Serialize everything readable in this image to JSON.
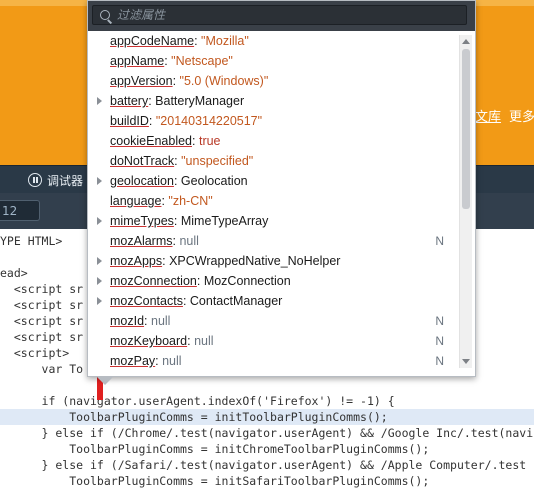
{
  "website": {
    "links": [
      "文库",
      "更多"
    ]
  },
  "devtools": {
    "debugger_tab": "调试器",
    "tab_box": "12"
  },
  "popup": {
    "filter_placeholder": "过滤属性",
    "rows": [
      {
        "key": "appCodeName",
        "value": "\"Mozilla\"",
        "vclass": "s",
        "expandable": false,
        "type": ""
      },
      {
        "key": "appName",
        "value": "\"Netscape\"",
        "vclass": "s",
        "expandable": false,
        "type": ""
      },
      {
        "key": "appVersion",
        "value": "\"5.0 (Windows)\"",
        "vclass": "s",
        "expandable": false,
        "type": ""
      },
      {
        "key": "battery",
        "value": "BatteryManager",
        "vclass": "",
        "expandable": true,
        "type": ""
      },
      {
        "key": "buildID",
        "value": "\"20140314220517\"",
        "vclass": "s",
        "expandable": false,
        "type": ""
      },
      {
        "key": "cookieEnabled",
        "value": "true",
        "vclass": "b",
        "expandable": false,
        "type": ""
      },
      {
        "key": "doNotTrack",
        "value": "\"unspecified\"",
        "vclass": "s",
        "expandable": false,
        "type": ""
      },
      {
        "key": "geolocation",
        "value": "Geolocation",
        "vclass": "",
        "expandable": true,
        "type": ""
      },
      {
        "key": "language",
        "value": "\"zh-CN\"",
        "vclass": "s",
        "expandable": false,
        "type": ""
      },
      {
        "key": "mimeTypes",
        "value": "MimeTypeArray",
        "vclass": "",
        "expandable": true,
        "type": ""
      },
      {
        "key": "mozAlarms",
        "value": "null",
        "vclass": "n",
        "expandable": false,
        "type": "N"
      },
      {
        "key": "mozApps",
        "value": "XPCWrappedNative_NoHelper",
        "vclass": "",
        "expandable": true,
        "type": ""
      },
      {
        "key": "mozConnection",
        "value": "MozConnection",
        "vclass": "",
        "expandable": true,
        "type": ""
      },
      {
        "key": "mozContacts",
        "value": "ContactManager",
        "vclass": "",
        "expandable": true,
        "type": ""
      },
      {
        "key": "mozId",
        "value": "null",
        "vclass": "n",
        "expandable": false,
        "type": "N"
      },
      {
        "key": "mozKeyboard",
        "value": "null",
        "vclass": "n",
        "expandable": false,
        "type": "N"
      },
      {
        "key": "mozPay",
        "value": "null",
        "vclass": "n",
        "expandable": false,
        "type": "N"
      }
    ]
  },
  "code": {
    "lines": [
      {
        "text": "YPE HTML>",
        "hl": false
      },
      {
        "text": "",
        "hl": false
      },
      {
        "text": "ead>",
        "hl": false
      },
      {
        "text": "  <script sr",
        "hl": false
      },
      {
        "text": "  <script sr",
        "hl": false
      },
      {
        "text": "  <script sr",
        "hl": false
      },
      {
        "text": "  <script sr",
        "hl": false
      },
      {
        "text": "  <script>",
        "hl": false
      },
      {
        "text": "      var To",
        "hl": false
      },
      {
        "text": "",
        "hl": false
      },
      {
        "text": "      if (navigator.userAgent.indexOf('Firefox') != -1) {",
        "hl": false
      },
      {
        "text": "          ToolbarPluginComms = initToolbarPluginComms();",
        "hl": true
      },
      {
        "text": "      } else if (/Chrome/.test(navigator.userAgent) && /Google Inc/.test(navi",
        "hl": false
      },
      {
        "text": "          ToolbarPluginComms = initChromeToolbarPluginComms();",
        "hl": false
      },
      {
        "text": "      } else if (/Safari/.test(navigator.userAgent) && /Apple Computer/.test",
        "hl": false
      },
      {
        "text": "          ToolbarPluginComms = initSafariToolbarPluginComms();",
        "hl": false
      }
    ]
  }
}
